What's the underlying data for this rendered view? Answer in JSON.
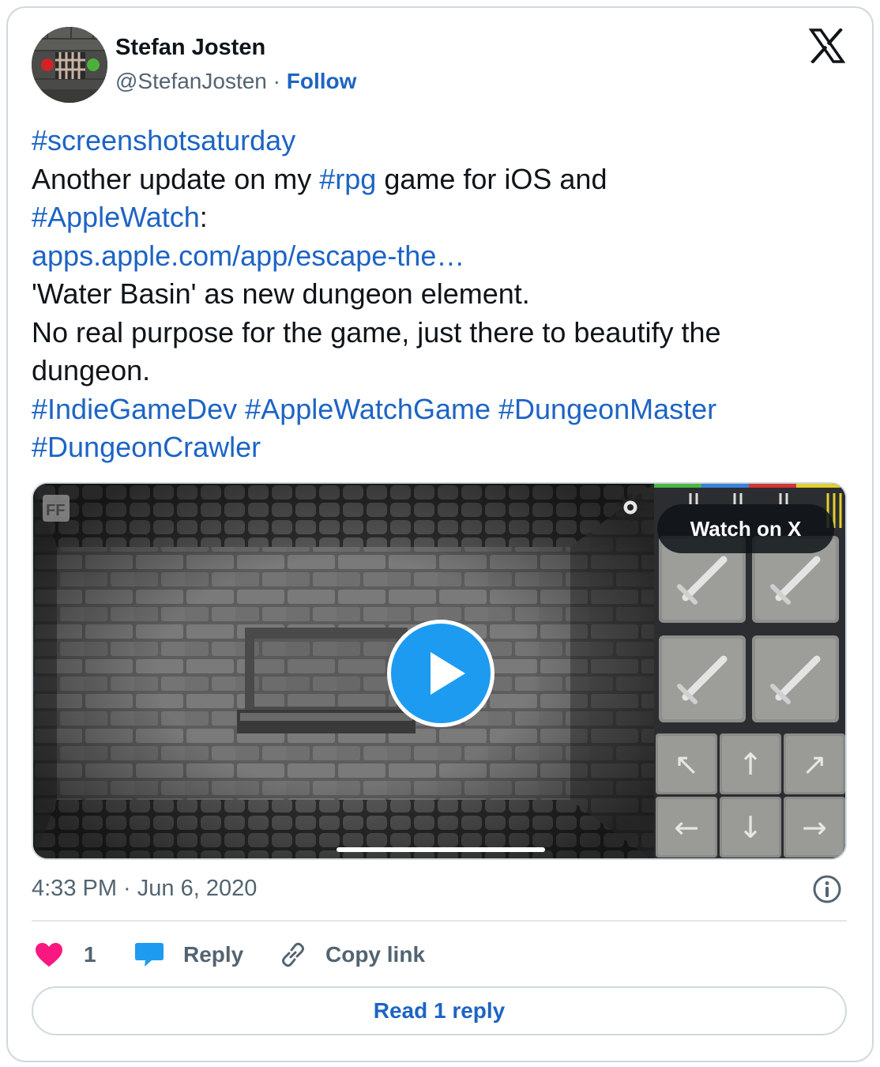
{
  "author": {
    "name": "Stefan Josten",
    "handle": "@StefanJosten",
    "separator": "·",
    "follow_label": "Follow"
  },
  "tweet": {
    "lines": [
      [
        {
          "t": "#screenshotsaturday",
          "link": true
        }
      ],
      [
        {
          "t": "Another update on my ",
          "link": false
        },
        {
          "t": "#rpg",
          "link": true
        },
        {
          "t": " game for iOS and",
          "link": false
        }
      ],
      [
        {
          "t": "#AppleWatch",
          "link": true
        },
        {
          "t": ":",
          "link": false
        }
      ],
      [
        {
          "t": "apps.apple.com/app/escape-the…",
          "link": true
        }
      ],
      [
        {
          "t": "'Water Basin' as new dungeon element.",
          "link": false
        }
      ],
      [
        {
          "t": "No real purpose for the game, just there to beautify the",
          "link": false
        }
      ],
      [
        {
          "t": "dungeon.",
          "link": false
        }
      ],
      [
        {
          "t": "#IndieGameDev",
          "link": true
        },
        {
          "t": " ",
          "link": false
        },
        {
          "t": "#AppleWatchGame",
          "link": true
        },
        {
          "t": " ",
          "link": false
        },
        {
          "t": "#DungeonMaster",
          "link": true
        }
      ],
      [
        {
          "t": "#DungeonCrawler",
          "link": true
        }
      ]
    ]
  },
  "media": {
    "watch_label": "Watch on X",
    "play_icon": "play-icon",
    "settings_icon": "gear-icon"
  },
  "footer": {
    "timestamp": "4:33 PM · Jun 6, 2020",
    "like_count": "1",
    "reply_label": "Reply",
    "copy_label": "Copy link",
    "read_replies_label": "Read 1 reply"
  },
  "colors": {
    "link": "#1d64c4",
    "like": "#f91880",
    "reply": "#1d9bf0",
    "muted": "#536471",
    "border": "#cfd9de"
  }
}
